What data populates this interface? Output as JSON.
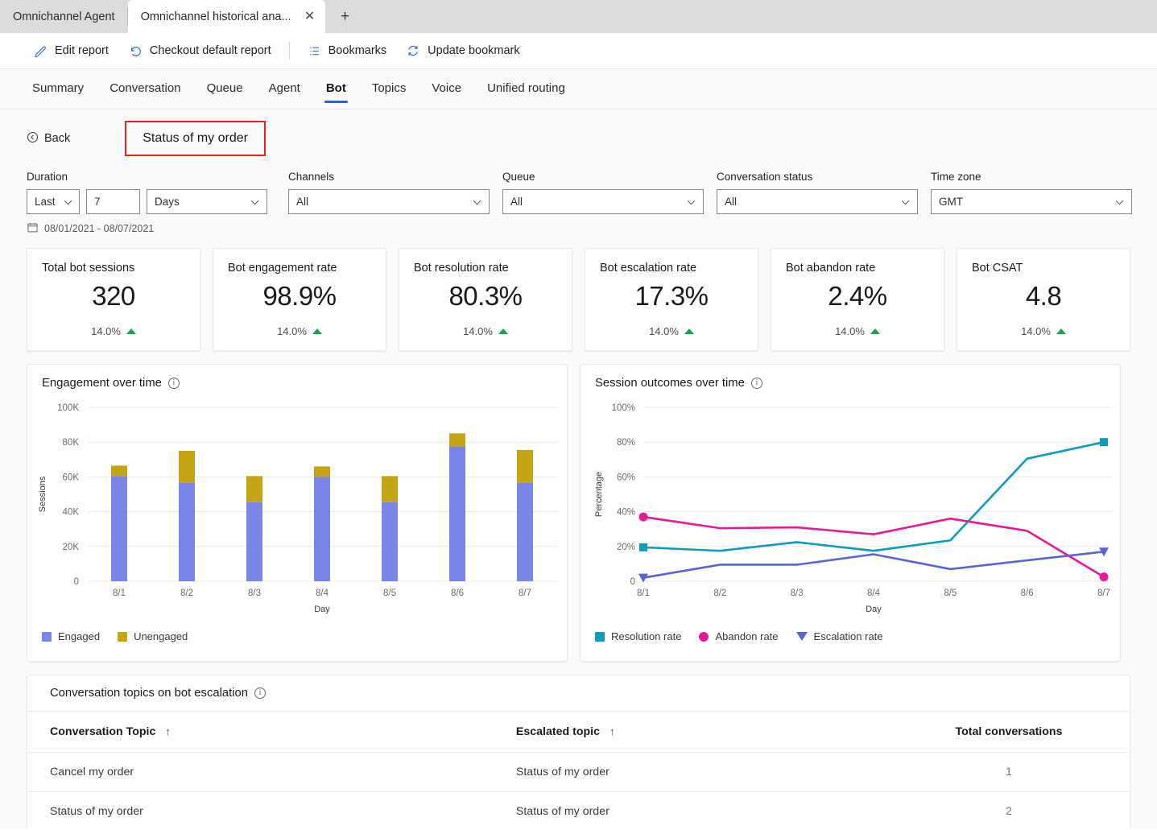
{
  "browser": {
    "tabs": [
      {
        "title": "Omnichannel Agent",
        "active": false
      },
      {
        "title": "Omnichannel historical ana...",
        "active": true
      }
    ],
    "close_glyph": "✕",
    "newtab_glyph": "+"
  },
  "commandbar": {
    "items": [
      {
        "label": "Edit report",
        "icon": "pencil-icon"
      },
      {
        "label": "Checkout default report",
        "icon": "undo-icon"
      },
      {
        "label": "Bookmarks",
        "icon": "bookmark-list-icon"
      },
      {
        "label": "Update bookmark",
        "icon": "refresh-icon"
      }
    ]
  },
  "nav": {
    "tabs": [
      {
        "label": "Summary",
        "selected": false
      },
      {
        "label": "Conversation",
        "selected": false
      },
      {
        "label": "Queue",
        "selected": false
      },
      {
        "label": "Agent",
        "selected": false
      },
      {
        "label": "Bot",
        "selected": true
      },
      {
        "label": "Topics",
        "selected": false
      },
      {
        "label": "Voice",
        "selected": false
      },
      {
        "label": "Unified routing",
        "selected": false
      }
    ],
    "accent": "#2266dd"
  },
  "breadcrumb": {
    "back_label": "Back",
    "title": "Status of my order",
    "highlight_color": "#e8231e"
  },
  "filters": {
    "duration": {
      "label": "Duration",
      "relative": "Last",
      "amount": "7",
      "unit": "Days"
    },
    "channels": {
      "label": "Channels",
      "value": "All"
    },
    "queue": {
      "label": "Queue",
      "value": "All"
    },
    "conversation_status": {
      "label": "Conversation status",
      "value": "All"
    },
    "time_zone": {
      "label": "Time zone",
      "value": "GMT"
    },
    "date_range": "08/01/2021 - 08/07/2021"
  },
  "kpis": [
    {
      "title": "Total bot sessions",
      "value": "320",
      "delta": "14.0%",
      "trend": "up"
    },
    {
      "title": "Bot engagement rate",
      "value": "98.9%",
      "delta": "14.0%",
      "trend": "up"
    },
    {
      "title": "Bot resolution rate",
      "value": "80.3%",
      "delta": "14.0%",
      "trend": "up"
    },
    {
      "title": "Bot escalation rate",
      "value": "17.3%",
      "delta": "14.0%",
      "trend": "up"
    },
    {
      "title": "Bot abandon rate",
      "value": "2.4%",
      "delta": "14.0%",
      "trend": "up"
    },
    {
      "title": "Bot CSAT",
      "value": "4.8",
      "delta": "14.0%",
      "trend": "up"
    }
  ],
  "charts": {
    "engagement": {
      "title": "Engagement over time"
    },
    "outcomes": {
      "title": "Session outcomes over time"
    }
  },
  "chart_data": [
    {
      "id": "engagement",
      "type": "bar",
      "stacked": true,
      "title": "Engagement over time",
      "xlabel": "Day",
      "ylabel": "Sessions",
      "categories": [
        "8/1",
        "8/2",
        "8/3",
        "8/4",
        "8/5",
        "8/6",
        "8/7"
      ],
      "ylim": [
        0,
        100000
      ],
      "yticks": [
        0,
        20000,
        40000,
        60000,
        80000,
        100000
      ],
      "yticklabels": [
        "0",
        "20K",
        "40K",
        "60K",
        "80K",
        "100K"
      ],
      "grid": true,
      "legend_position": "bottom-left",
      "series": [
        {
          "name": "Engaged",
          "color": "#7986e7",
          "values": [
            60500,
            56500,
            45500,
            60000,
            45500,
            77500,
            56500
          ]
        },
        {
          "name": "Unengaged",
          "color": "#c5a516",
          "values": [
            6000,
            18500,
            15000,
            6000,
            15000,
            7500,
            19000
          ]
        }
      ]
    },
    {
      "id": "outcomes",
      "type": "line",
      "title": "Session outcomes over time",
      "xlabel": "Day",
      "ylabel": "Percentage",
      "categories": [
        "8/1",
        "8/2",
        "8/3",
        "8/4",
        "8/5",
        "8/6",
        "8/7"
      ],
      "ylim": [
        0,
        100
      ],
      "yticks": [
        0,
        20,
        40,
        60,
        80,
        100
      ],
      "yticklabels": [
        "0",
        "20%",
        "40%",
        "60%",
        "80%",
        "100%"
      ],
      "grid": true,
      "legend_position": "bottom-left",
      "series": [
        {
          "name": "Resolution rate",
          "color": "#0f9bbb",
          "marker": "square",
          "values": [
            19.5,
            17.5,
            22.5,
            17.5,
            23.5,
            70.5,
            80.0
          ]
        },
        {
          "name": "Abandon rate",
          "color": "#e6199a",
          "marker": "circle",
          "values": [
            37.0,
            30.5,
            31.0,
            27.0,
            36.0,
            29.0,
            2.5
          ]
        },
        {
          "name": "Escalation rate",
          "color": "#5864d8",
          "marker": "triangle",
          "values": [
            2.0,
            9.5,
            9.5,
            15.5,
            7.0,
            12.0,
            17.0
          ]
        }
      ]
    }
  ],
  "topics_table": {
    "title": "Conversation topics on bot escalation",
    "sort_glyph": "↑",
    "columns": [
      "Conversation Topic",
      "Escalated topic",
      "Total conversations"
    ],
    "rows": [
      {
        "topic": "Cancel my order",
        "escalated": "Status of my order",
        "total": "1"
      },
      {
        "topic": "Status of my order",
        "escalated": "Status of my order",
        "total": "2"
      }
    ]
  }
}
